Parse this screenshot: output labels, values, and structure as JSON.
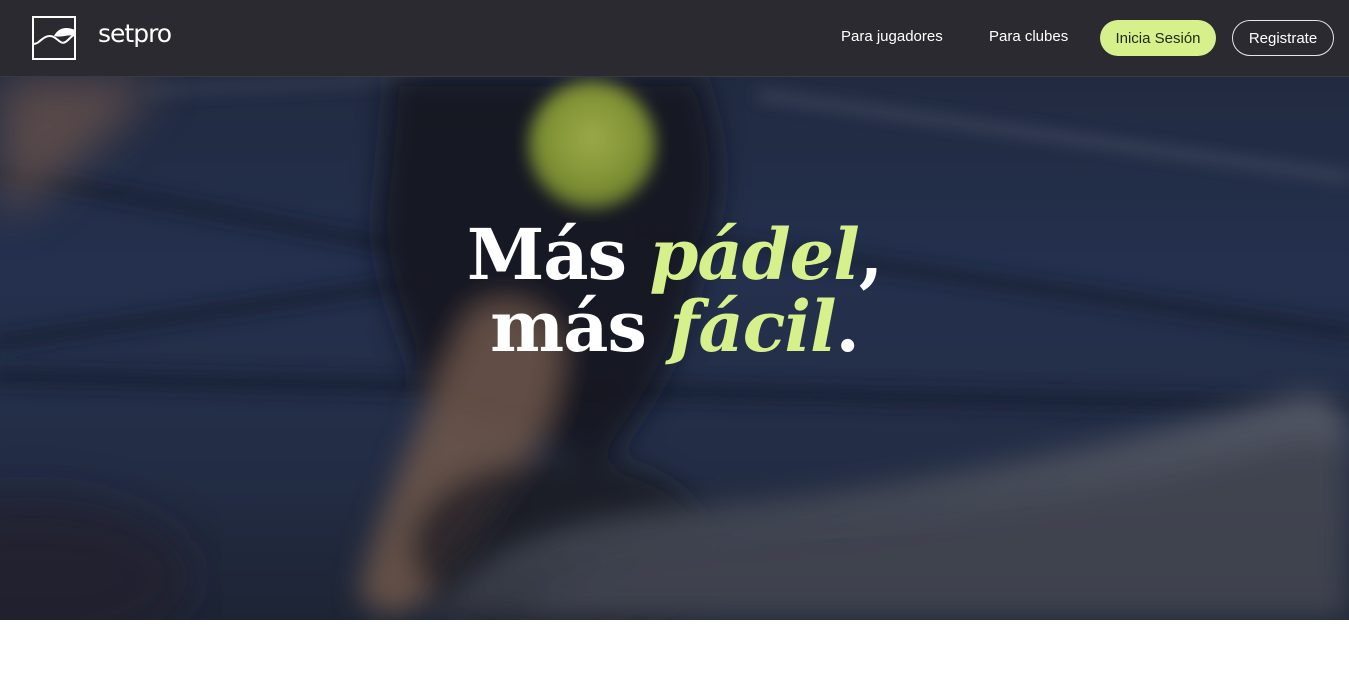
{
  "brand": {
    "name": "setpro",
    "logo_icon": "wave-square-logo"
  },
  "nav": {
    "links": [
      {
        "label": "Para jugadores"
      },
      {
        "label": "Para clubes"
      }
    ],
    "login_label": "Inicia Sesión",
    "register_label": "Registrate"
  },
  "hero": {
    "line1_start": "Más ",
    "line1_accent": "pádel",
    "line1_end": ",",
    "line2_start": "más ",
    "line2_accent": "fácil",
    "line2_end": "."
  },
  "colors": {
    "nav_background": "#2a2a30",
    "accent": "#d6f08c",
    "hero_court": "#2b3a5c",
    "text": "#ffffff"
  }
}
